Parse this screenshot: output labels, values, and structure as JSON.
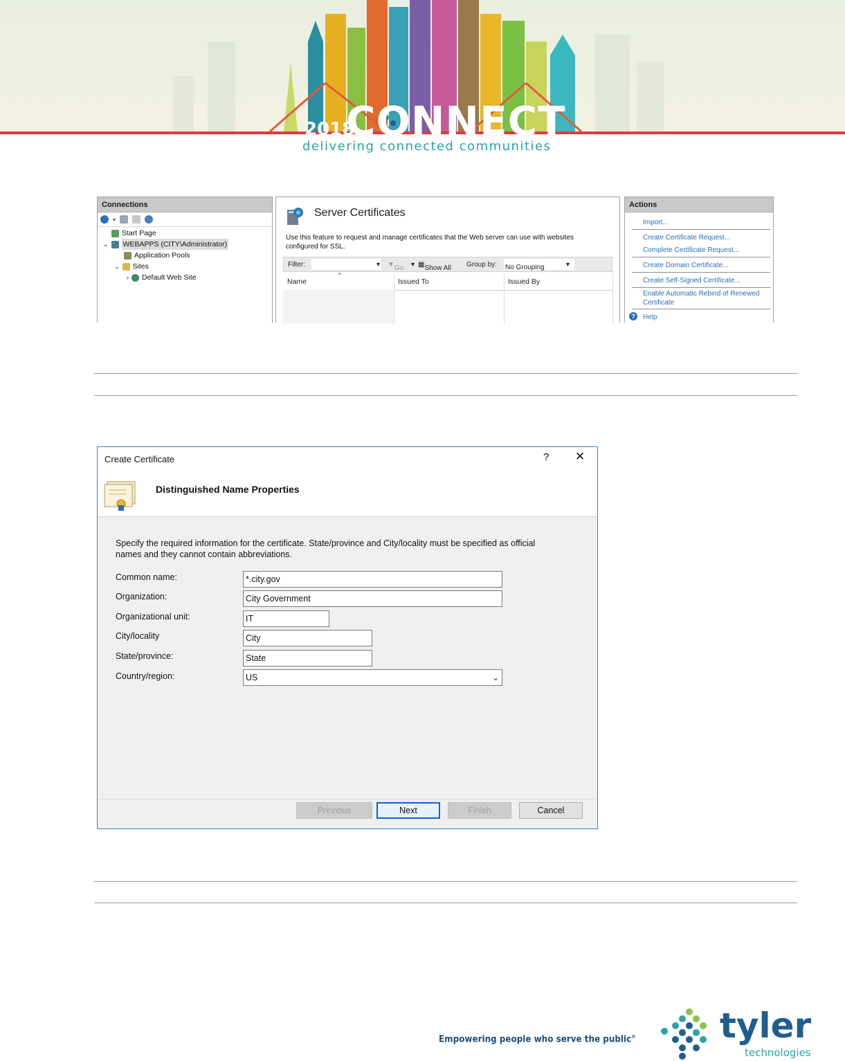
{
  "banner": {
    "year": "2018",
    "brand": "CONNECT",
    "tagline": "delivering connected communities"
  },
  "iis": {
    "connections": {
      "header": "Connections",
      "tree": [
        {
          "label": "Start Page"
        },
        {
          "label": "WEBAPPS (CITY\\Administrator)"
        },
        {
          "label": "Application Pools"
        },
        {
          "label": "Sites"
        },
        {
          "label": "Default Web Site"
        }
      ]
    },
    "center": {
      "title": "Server Certificates",
      "description": "Use this feature to request and manage certificates that the Web server can use with websites configured for SSL.",
      "filter_label": "Filter:",
      "go_label": "Go",
      "show_all_label": "Show All",
      "group_by_label": "Group by:",
      "group_by_value": "No Grouping",
      "columns": [
        "Name",
        "Issued To",
        "Issued By"
      ]
    },
    "actions": {
      "header": "Actions",
      "items": [
        "Import...",
        "Create Certificate Request...",
        "Complete Certificate Request...",
        "Create Domain Certificate...",
        "Create Self-Signed Certificate...",
        "Enable Automatic Rebind of Renewed Certificate",
        "Help"
      ]
    }
  },
  "dialog": {
    "title": "Create Certificate",
    "help": "?",
    "close": "✕",
    "heading": "Distinguished Name Properties",
    "instructions": "Specify the required information for the certificate. State/province and City/locality must be specified as official names and they cannot contain abbreviations.",
    "fields": [
      {
        "label": "Common name:",
        "value": "*.city.gov"
      },
      {
        "label": "Organization:",
        "value": "City Government"
      },
      {
        "label": "Organizational unit:",
        "value": "IT"
      },
      {
        "label": "City/locality",
        "value": "City"
      },
      {
        "label": "State/province:",
        "value": "State"
      },
      {
        "label": "Country/region:",
        "value": "US"
      }
    ],
    "buttons": {
      "previous": "Previous",
      "next": "Next",
      "finish": "Finish",
      "cancel": "Cancel"
    }
  },
  "footer": {
    "slogan": "Empowering people who serve the public",
    "registered": "®",
    "brand": "tyler",
    "brand_sub": "technologies"
  },
  "colors": {
    "accent_red": "#e03a3e",
    "tyler_blue": "#1f5f8f",
    "tyler_teal": "#2aa5a7",
    "link_blue": "#2a6fb8",
    "dialog_border": "#3c7fd1"
  }
}
